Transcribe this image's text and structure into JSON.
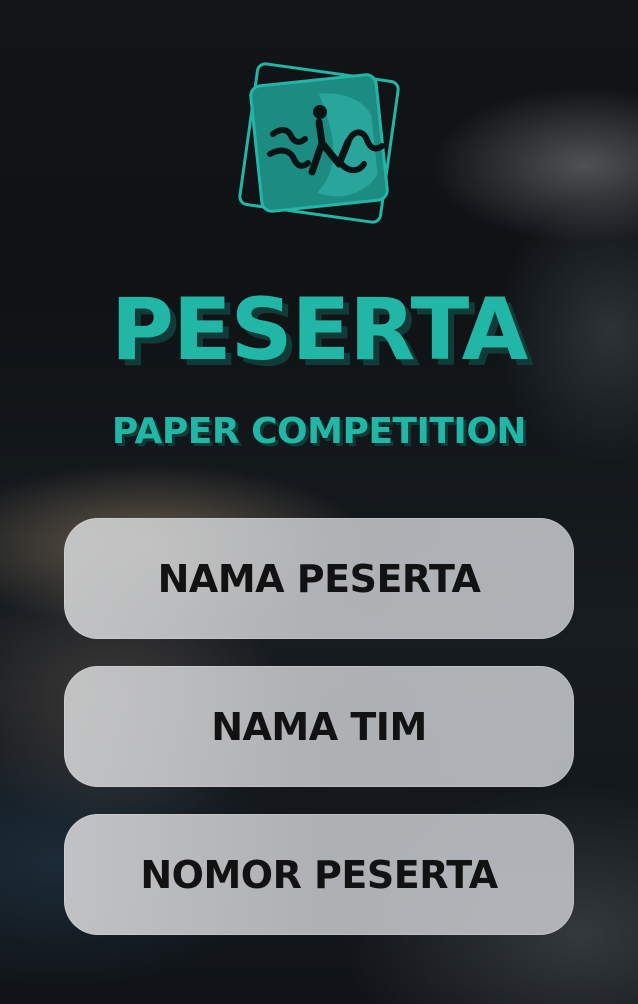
{
  "header": {
    "title": "PESERTA",
    "subtitle": "PAPER COMPETITION"
  },
  "fields": [
    {
      "label": "NAMA PESERTA"
    },
    {
      "label": "NAMA TIM"
    },
    {
      "label": "NOMOR PESERTA"
    }
  ],
  "colors": {
    "accent": "#21b6a6",
    "accent_shadow": "#103b38",
    "button_bg": "#c7c9cb",
    "button_text": "#121212",
    "background": "#0d1114"
  },
  "logo": {
    "icon": "dancing-figure-logo"
  }
}
